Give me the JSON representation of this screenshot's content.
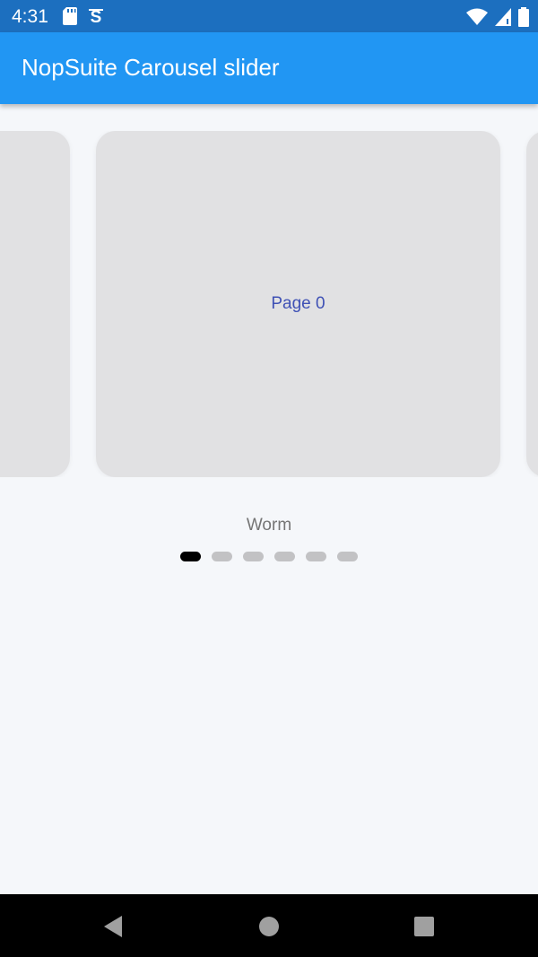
{
  "status_bar": {
    "time": "4:31",
    "left_icons": [
      "sd-card-icon",
      "sync-icon"
    ],
    "right_icons": [
      "wifi-icon",
      "cell-signal-icon",
      "battery-icon"
    ]
  },
  "app_bar": {
    "title": "NopSuite Carousel slider"
  },
  "carousel": {
    "current_page_label": "Page 0",
    "current_index": 0,
    "page_count": 6
  },
  "indicator": {
    "effect_label": "Worm",
    "active_index": 0
  },
  "colors": {
    "app_bar": "#2196f3",
    "status_bar": "#1c6fbf",
    "card": "#e1e1e3",
    "page_text": "#3f51b5",
    "dot_inactive": "#c2c2c4",
    "dot_active": "#000000"
  },
  "nav_bar": {
    "buttons": [
      "back-icon",
      "home-icon",
      "recents-icon"
    ]
  }
}
